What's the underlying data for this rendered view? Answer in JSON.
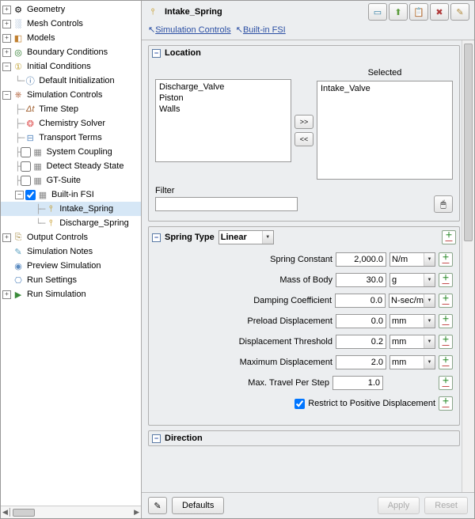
{
  "tree": {
    "geometry": "Geometry",
    "mesh_controls": "Mesh Controls",
    "models": "Models",
    "boundary_conditions": "Boundary Conditions",
    "initial_conditions": "Initial Conditions",
    "default_init": "Default Initialization",
    "sim_controls": "Simulation Controls",
    "time_step": "Time Step",
    "chemistry_solver": "Chemistry Solver",
    "transport_terms": "Transport Terms",
    "system_coupling": "System Coupling",
    "detect_steady": "Detect Steady State",
    "gt_suite": "GT-Suite",
    "built_in_fsi": "Built-in FSI",
    "intake_spring": "Intake_Spring",
    "discharge_spring": "Discharge_Spring",
    "output_controls": "Output Controls",
    "sim_notes": "Simulation Notes",
    "preview_sim": "Preview Simulation",
    "run_settings": "Run Settings",
    "run_sim": "Run Simulation"
  },
  "header": {
    "title": "Intake_Spring"
  },
  "breadcrumb": {
    "a": "Simulation Controls",
    "b": "Built-in FSI"
  },
  "sections": {
    "location": "Location",
    "spring_type": "Spring Type",
    "direction": "Direction"
  },
  "location": {
    "available": [
      "Discharge_Valve",
      "Piston",
      "Walls"
    ],
    "selected_label": "Selected",
    "selected": [
      "Intake_Valve"
    ],
    "filter_label": "Filter",
    "filter_value": ""
  },
  "spring": {
    "type_value": "Linear",
    "rows": {
      "spring_constant": {
        "label": "Spring Constant",
        "value": "2,000.0",
        "unit": "N/m"
      },
      "mass_of_body": {
        "label": "Mass of Body",
        "value": "30.0",
        "unit": "g"
      },
      "damping": {
        "label": "Damping Coefficient",
        "value": "0.0",
        "unit": "N-sec/m"
      },
      "preload": {
        "label": "Preload Displacement",
        "value": "0.0",
        "unit": "mm"
      },
      "threshold": {
        "label": "Displacement Threshold",
        "value": "0.2",
        "unit": "mm"
      },
      "max_disp": {
        "label": "Maximum Displacement",
        "value": "2.0",
        "unit": "mm"
      },
      "max_travel": {
        "label": "Max. Travel Per Step",
        "value": "1.0"
      }
    },
    "restrict_label": "Restrict to Positive Displacement",
    "restrict_checked": true
  },
  "footer": {
    "defaults": "Defaults",
    "apply": "Apply",
    "reset": "Reset"
  }
}
